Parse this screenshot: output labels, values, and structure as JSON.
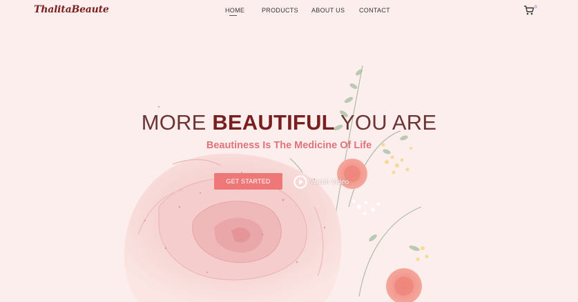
{
  "brand": {
    "logo": "ThalitaBeaute"
  },
  "nav": {
    "items": [
      {
        "label": "HOME",
        "active": true
      },
      {
        "label": "PRODUCTS",
        "active": false
      },
      {
        "label": "ABOUT US",
        "active": false
      },
      {
        "label": "CONTACT",
        "active": false
      }
    ]
  },
  "cart": {
    "icon": "cart-icon",
    "count": "0"
  },
  "hero": {
    "title_light_1": "MORE ",
    "title_bold": "BEAUTIFUL",
    "title_light_2": " YOU ARE",
    "subtitle": "Beautiness Is The Medicine Of Life",
    "cta_label": "GET STARTED",
    "watch_label": "Watch Video",
    "watch_icon": "play-circle-icon"
  },
  "colors": {
    "background": "#fdeeee",
    "accent": "#ee7777",
    "title": "#7a1f1f",
    "subtitle": "#e0727a"
  }
}
